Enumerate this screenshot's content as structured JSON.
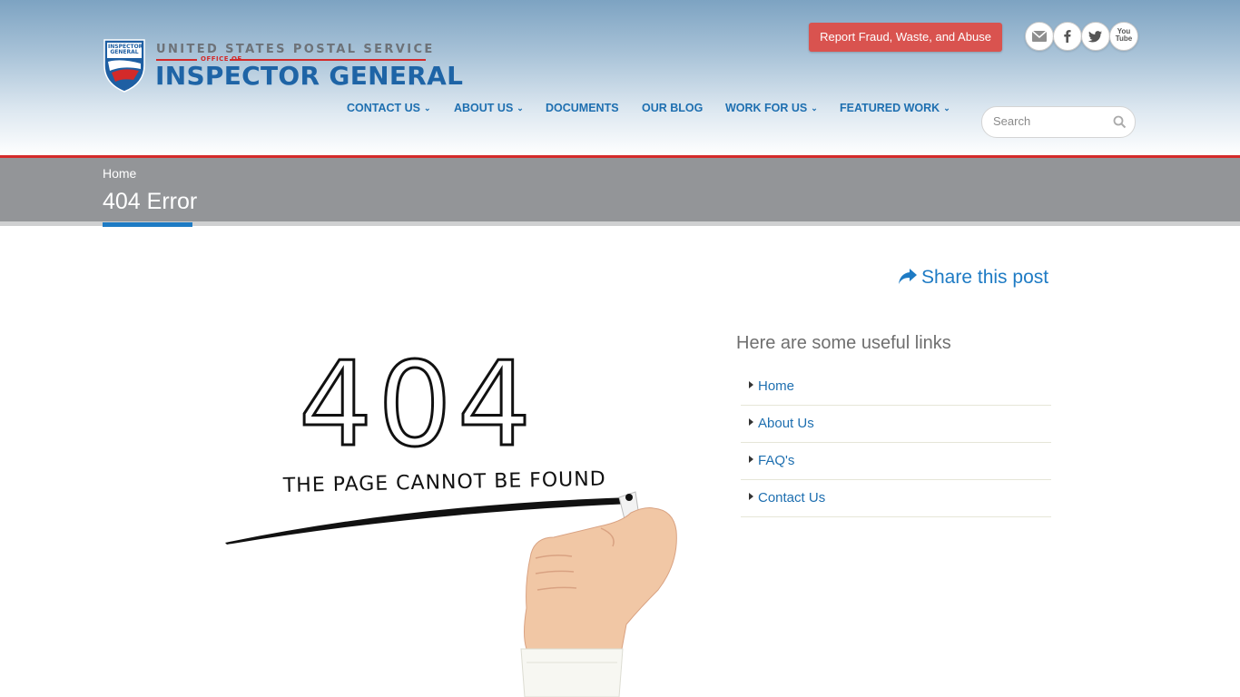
{
  "logo": {
    "line1": "UNITED STATES POSTAL SERVICE",
    "line2": "OFFICE OF",
    "line3": "INSPECTOR GENERAL",
    "badge_text": "INSPECTOR GENERAL"
  },
  "header": {
    "report_button": "Report Fraud, Waste, and Abuse",
    "social": [
      "mail-icon",
      "facebook-icon",
      "twitter-icon",
      "youtube-icon"
    ],
    "youtube_text": "You Tube"
  },
  "nav": {
    "items": [
      {
        "label": "CONTACT US",
        "dropdown": true
      },
      {
        "label": "ABOUT US",
        "dropdown": true
      },
      {
        "label": "DOCUMENTS",
        "dropdown": false
      },
      {
        "label": "OUR BLOG",
        "dropdown": false
      },
      {
        "label": "WORK FOR US",
        "dropdown": true
      },
      {
        "label": "FEATURED WORK",
        "dropdown": true
      }
    ],
    "chevron": "⌄"
  },
  "search": {
    "placeholder": "Search",
    "value": ""
  },
  "page": {
    "breadcrumb": "Home",
    "title": "404 Error",
    "share_label": "Share this post"
  },
  "illustration": {
    "big_text": "404",
    "caption": "THE PAGE CANNOT BE FOUND"
  },
  "sidebar": {
    "heading": "Here are some useful links",
    "links": [
      "Home",
      "About Us",
      "FAQ's",
      "Contact Us"
    ]
  },
  "colors": {
    "accent": "#1e7bc4",
    "brand_red": "#d42a2a",
    "report_red": "#d9534f",
    "titlebar_gray": "#939598"
  }
}
